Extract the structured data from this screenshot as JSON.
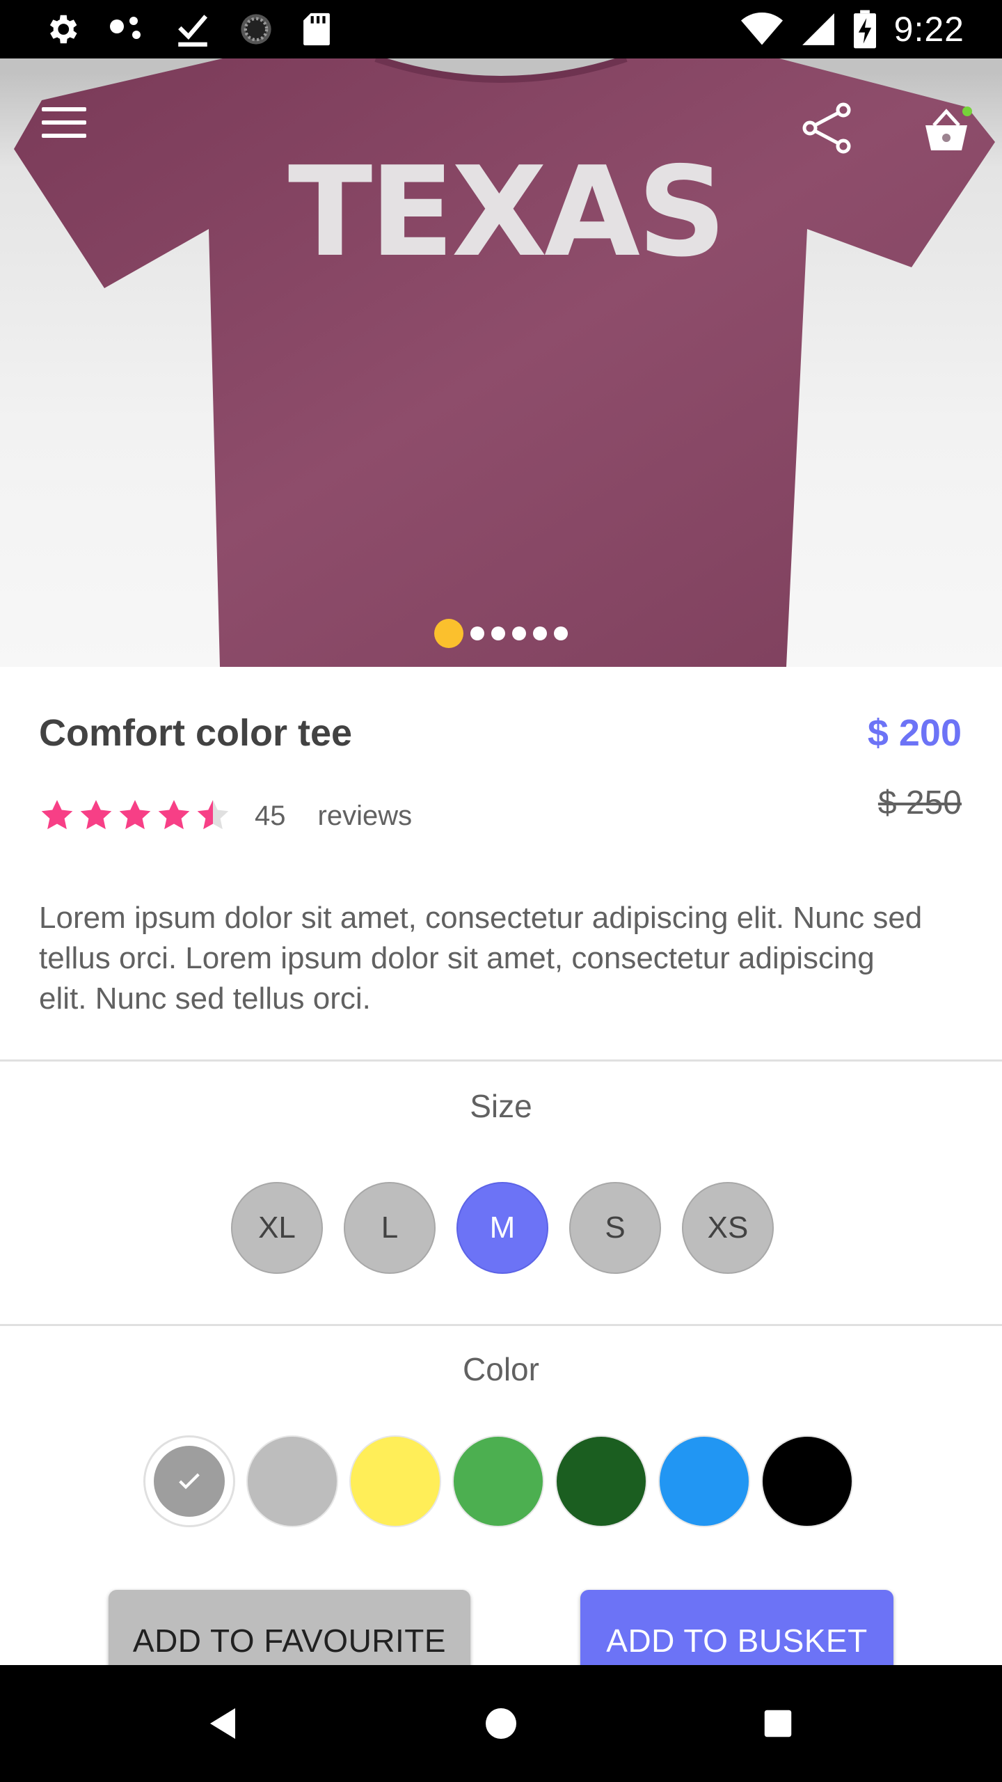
{
  "status_bar": {
    "time": "9:22",
    "left_icons": [
      "gear-icon",
      "dots-icon",
      "download-done-icon",
      "spinner-icon",
      "sd-card-icon"
    ],
    "right_icons": [
      "wifi-icon",
      "signal-icon",
      "battery-charging-icon"
    ]
  },
  "hero": {
    "shirt_text": "TEXAS",
    "shirt_color": "#8a4866",
    "slide_count": 6,
    "active_slide": 1,
    "active_dot_color": "#fbc02d"
  },
  "product": {
    "title": "Comfort color tee",
    "price": "$ 200",
    "old_price": "$ 250",
    "rating": 4.5,
    "review_count": "45",
    "review_label": "reviews",
    "description": "Lorem ipsum dolor sit amet, consectetur adipiscing elit. Nunc sed tellus orci. Lorem ipsum dolor sit amet, consectetur adipiscing elit. Nunc sed tellus orci."
  },
  "size_section": {
    "title": "Size",
    "options": [
      "XL",
      "L",
      "M",
      "S",
      "XS"
    ],
    "selected": "M"
  },
  "color_section": {
    "title": "Color",
    "options": [
      "#9e9e9e",
      "#bdbdbd",
      "#ffee58",
      "#4caf50",
      "#1b5e20",
      "#2196f3",
      "#000000"
    ],
    "selected_index": 0
  },
  "actions": {
    "favourite_label": "ADD TO FAVOURITE",
    "basket_label": "ADD TO BUSKET"
  },
  "colors": {
    "accent": "#6c73f6",
    "star": "#f73f86",
    "basket_badge": "#76d33a"
  }
}
